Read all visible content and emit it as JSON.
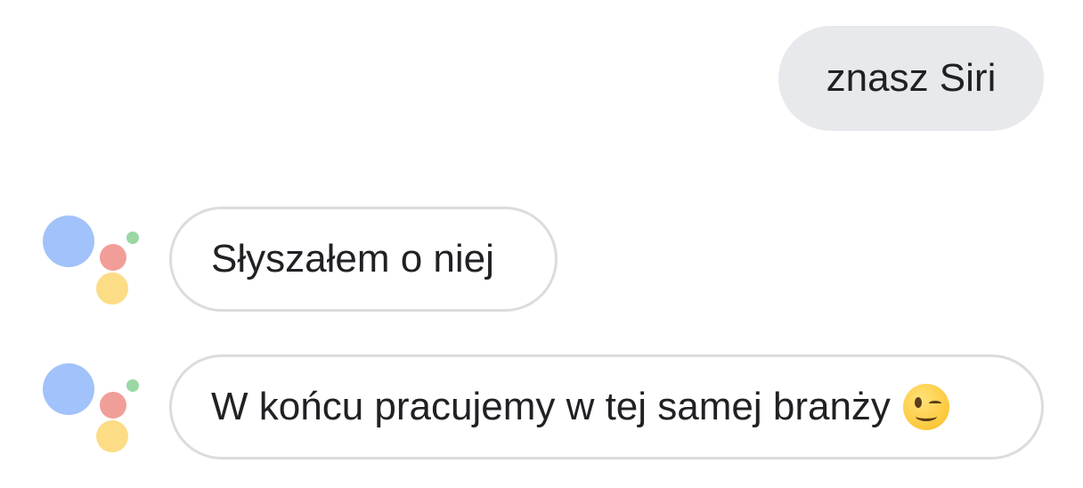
{
  "conversation": {
    "user_message": {
      "text": "znasz Siri"
    },
    "assistant_messages": [
      {
        "text": "Słyszałem o niej",
        "emoji": ""
      },
      {
        "text": "W końcu pracujemy w tej samej branży",
        "emoji": "winking-face"
      }
    ]
  },
  "icons": {
    "assistant_logo": "google-assistant-icon",
    "emoji": "winking-face-emoji"
  },
  "colors": {
    "user_bubble_bg": "#e8e9ed",
    "assistant_bubble_border": "#dcdcdc",
    "text": "#202124",
    "logo_blue": "#a1c2fa",
    "logo_red": "#f19e98",
    "logo_yellow": "#fddc86",
    "logo_green": "#9ad7a4"
  }
}
